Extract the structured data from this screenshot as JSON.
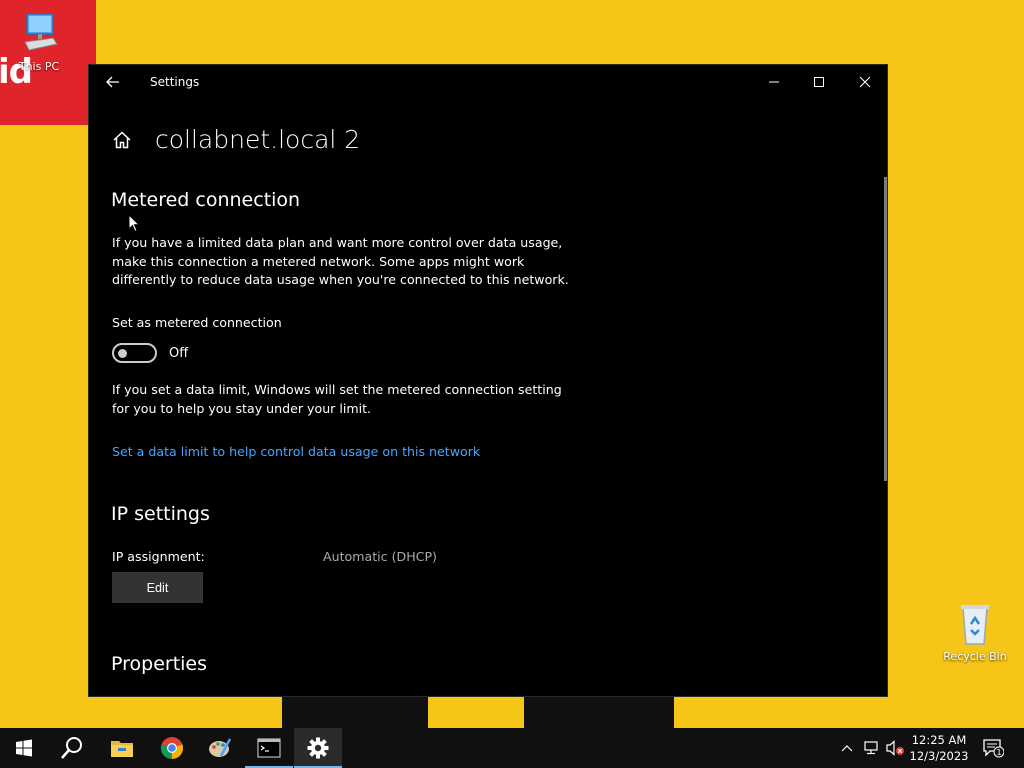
{
  "desktop": {
    "this_pc_label": "This PC",
    "recycle_bin_label": "Recycle Bin",
    "wallpaper_color": "#f5c518",
    "brand_block_color": "#e0242b"
  },
  "window": {
    "title": "Settings",
    "page_title": "collabnet.local 2",
    "icons": {
      "back": "back-arrow-icon",
      "home": "home-icon",
      "minimize": "minimize-icon",
      "maximize": "maximize-icon",
      "close": "close-icon"
    }
  },
  "metered": {
    "heading": "Metered connection",
    "description_lines": [
      "If you have a limited data plan and want more control over data usage,",
      "make this connection a metered network. Some apps might work",
      "differently to reduce data usage when you're connected to this network."
    ],
    "toggle_label": "Set as metered connection",
    "toggle_state": "Off",
    "limit_lines": [
      "If you set a data limit, Windows will set the metered connection setting",
      "for you to help you stay under your limit."
    ],
    "data_limit_link": "Set a data limit to help control data usage on this network",
    "link_color": "#4aa3ff"
  },
  "ip": {
    "heading": "IP settings",
    "assignment_label": "IP assignment:",
    "assignment_value": "Automatic (DHCP)",
    "edit_label": "Edit"
  },
  "properties": {
    "heading": "Properties"
  },
  "taskbar": {
    "apps": [
      "start-icon",
      "search-icon",
      "file-explorer-icon",
      "chrome-icon",
      "paint-icon",
      "terminal-icon",
      "settings-icon"
    ],
    "active_app": "settings-icon",
    "clock_time": "12:25 AM",
    "clock_date": "12/3/2023",
    "notification_count": "1"
  }
}
